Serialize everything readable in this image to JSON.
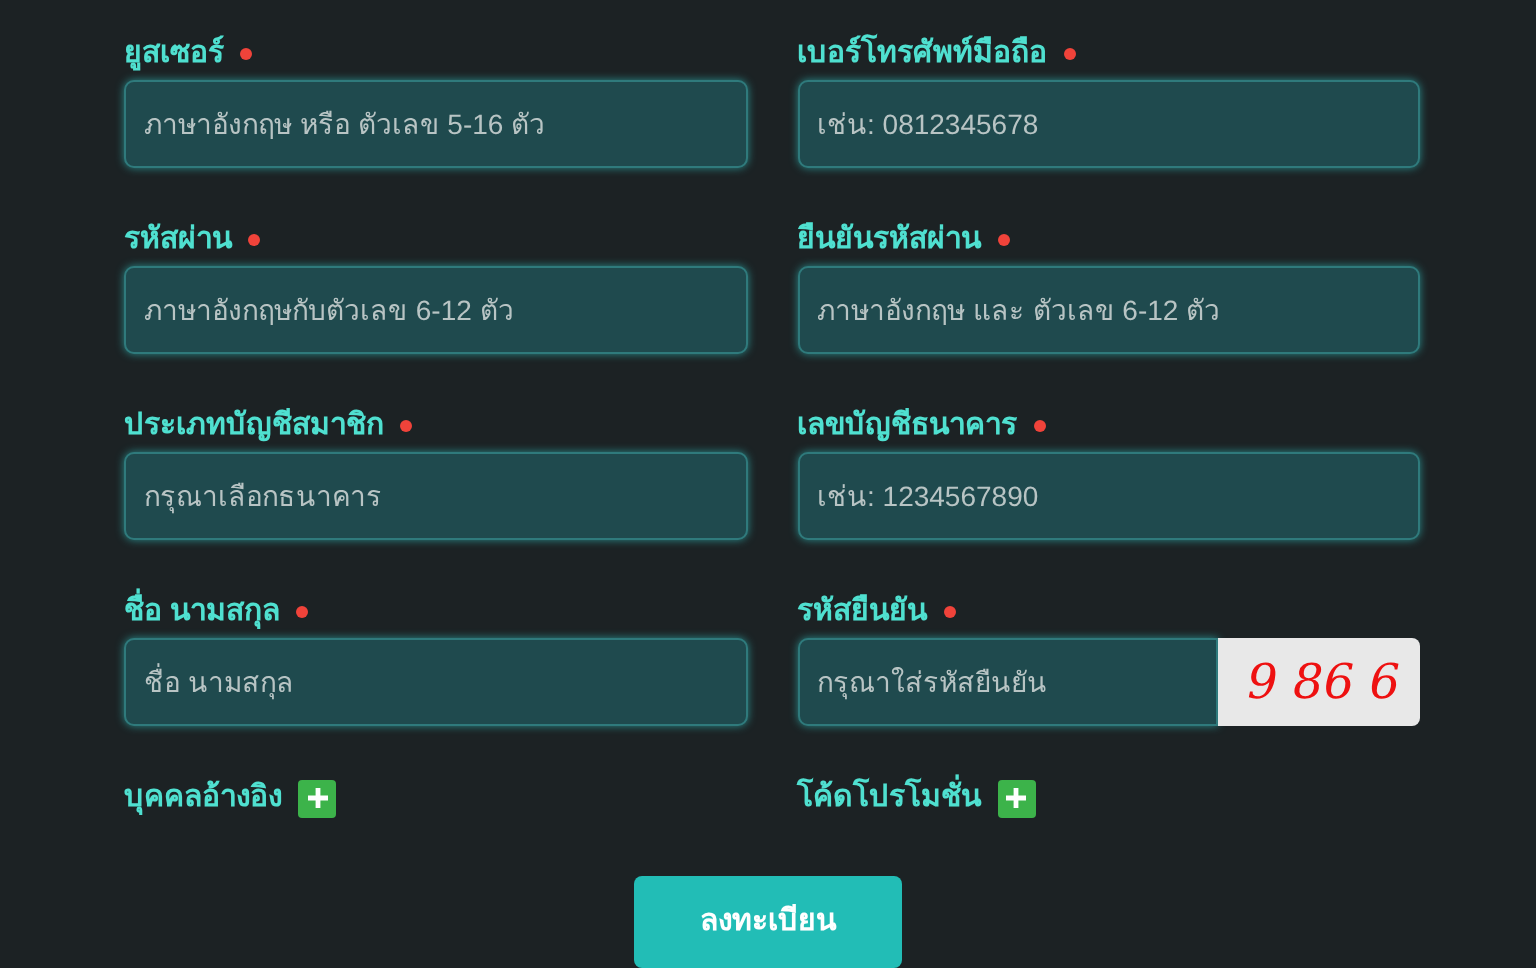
{
  "fields": [
    {
      "label": "ยูสเซอร์",
      "required": true,
      "placeholder": "ภาษาอังกฤษ หรือ ตัวเลข 5-16 ตัว",
      "kind": "text"
    },
    {
      "label": "เบอร์โทรศัพท์มือถือ",
      "required": true,
      "placeholder": "เช่น: 0812345678",
      "kind": "text"
    },
    {
      "label": "รหัสผ่าน",
      "required": true,
      "placeholder": "ภาษาอังกฤษกับตัวเลข 6-12 ตัว",
      "kind": "text"
    },
    {
      "label": "ยืนยันรหัสผ่าน",
      "required": true,
      "placeholder": "ภาษาอังกฤษ และ ตัวเลข 6-12 ตัว",
      "kind": "text"
    },
    {
      "label": "ประเภทบัญชีสมาชิก",
      "required": true,
      "placeholder": "กรุณาเลือกธนาคาร",
      "kind": "text"
    },
    {
      "label": "เลขบัญชีธนาคาร",
      "required": true,
      "placeholder": "เช่น: 1234567890",
      "kind": "text"
    },
    {
      "label": "ชื่อ นามสกุล",
      "required": true,
      "placeholder": "ชื่อ นามสกุล",
      "kind": "text"
    },
    {
      "label": "รหัสยืนยัน",
      "required": true,
      "placeholder": "กรุณาใส่รหัสยืนยัน",
      "kind": "captcha",
      "captcha": "9 86 6"
    }
  ],
  "expanders": [
    {
      "label": "บุคคลอ้างอิง"
    },
    {
      "label": "โค้ดโปรโมชั่น"
    }
  ],
  "submit": "ลงทะเบียน"
}
